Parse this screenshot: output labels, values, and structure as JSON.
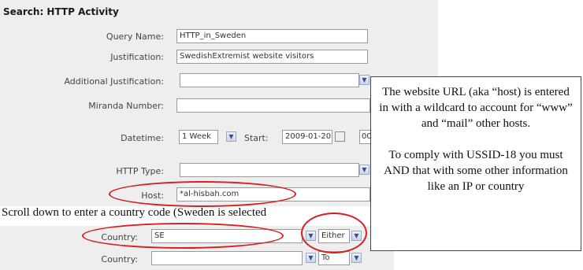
{
  "form": {
    "title": "Search: HTTP Activity",
    "query_name": {
      "label": "Query Name:",
      "value": "HTTP_in_Sweden"
    },
    "justification": {
      "label": "Justification:",
      "value": "SwedishExtremist website visitors"
    },
    "additional_justification": {
      "label": "Additional Justification:",
      "value": ""
    },
    "miranda_number": {
      "label": "Miranda Number:",
      "value": ""
    },
    "datetime": {
      "label": "Datetime:",
      "selected": "1 Week",
      "start_label": "Start:",
      "start_value": "2009-01-20",
      "overflow": "00"
    },
    "http_type": {
      "label": "HTTP Type:",
      "value": ""
    },
    "host": {
      "label": "Host:",
      "value": "*al-hisbah.com"
    },
    "country1": {
      "label": "Country:",
      "value": "SE",
      "operator": "Either"
    },
    "country2": {
      "label": "Country:",
      "value": "",
      "operator": "To"
    }
  },
  "annotations": {
    "callout_para1": "The website URL (aka “host) is entered in with a wildcard to account for “www” and “mail” other hosts.",
    "callout_para2": "To comply with USSID-18 you must AND that with some other information like an IP or country",
    "scroll_note": "Scroll down to enter a country code (Sweden is selected"
  },
  "colors": {
    "panel": "#eeeeee",
    "highlight": "#d42020"
  },
  "icons": {
    "dropdown": "chevron-down-icon",
    "calendar": "calendar-icon"
  }
}
